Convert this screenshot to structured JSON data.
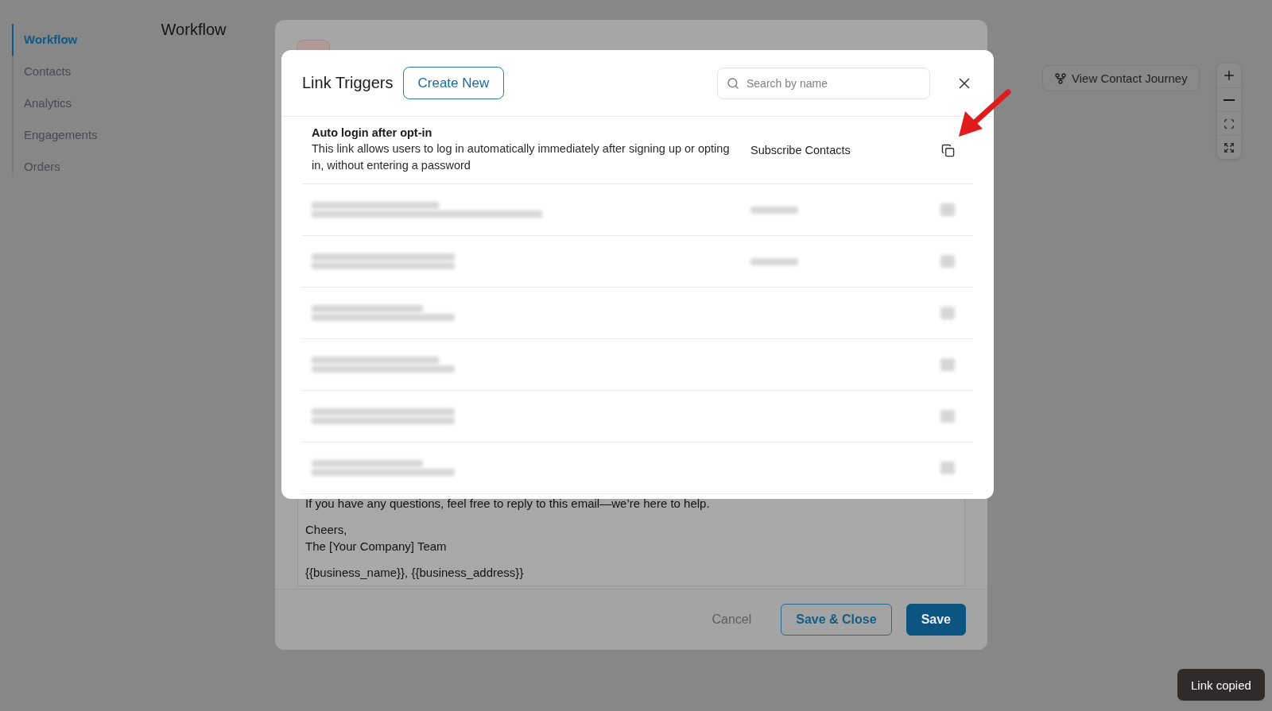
{
  "sidebar": {
    "items": [
      {
        "label": "Workflow",
        "selected": true
      },
      {
        "label": "Contacts",
        "selected": false
      },
      {
        "label": "Analytics",
        "selected": false
      },
      {
        "label": "Engagements",
        "selected": false
      },
      {
        "label": "Orders",
        "selected": false
      }
    ]
  },
  "page_title": "Workflow",
  "journey_button": {
    "label": "View Contact Journey"
  },
  "zoom_controls": [
    {
      "kind": "zoom_in"
    },
    {
      "kind": "zoom_out"
    },
    {
      "kind": "fit"
    },
    {
      "kind": "fullscreen"
    }
  ],
  "editor": {
    "paragraphs": [
      [
        "If you have any questions, feel free to reply to this email—we’re here to help."
      ],
      [
        "Cheers,",
        "The [Your Company] Team"
      ],
      [
        "{{business_name}}, {{business_address}}"
      ]
    ],
    "buttons": [
      {
        "kind": "text",
        "label": "Cancel"
      },
      {
        "kind": "outline",
        "label": "Save & Close"
      },
      {
        "kind": "primary",
        "label": "Save"
      }
    ]
  },
  "link_modal": {
    "title": "Link Triggers",
    "create_button": "Create New",
    "search": {
      "placeholder": "Search by name"
    },
    "rows": [
      {
        "kind": "trigger",
        "title": "Auto login after opt-in",
        "description": "This link allows users to log in automatically immediately after signing up or opting in, without entering a password",
        "event": "Subscribe Contacts"
      },
      {
        "kind": "redacted",
        "event_shown": true
      },
      {
        "kind": "redacted",
        "event_shown": true
      },
      {
        "kind": "redacted",
        "event_shown": false
      },
      {
        "kind": "redacted",
        "event_shown": false
      },
      {
        "kind": "redacted",
        "event_shown": false
      },
      {
        "kind": "redacted",
        "event_shown": false
      }
    ]
  },
  "toast": "Link copied",
  "annotation": {
    "kind": "arrow"
  }
}
